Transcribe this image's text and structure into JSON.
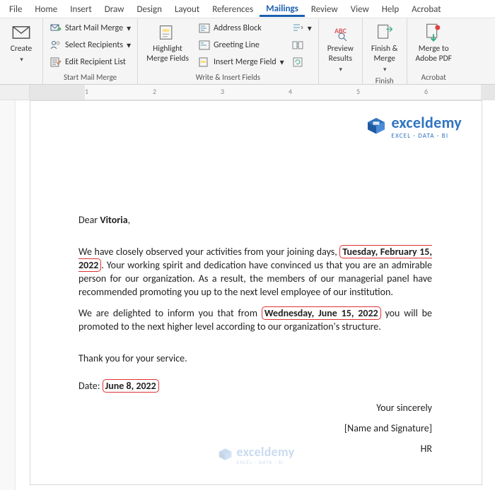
{
  "tabs": [
    "File",
    "Home",
    "Insert",
    "Draw",
    "Design",
    "Layout",
    "References",
    "Mailings",
    "Review",
    "View",
    "Help",
    "Acrobat"
  ],
  "activeTab": "Mailings",
  "ribbon": {
    "create": {
      "label": "Create"
    },
    "startMerge": {
      "groupLabel": "Start Mail Merge",
      "startMailMerge": "Start Mail Merge",
      "selectRecipients": "Select Recipients",
      "editRecipientList": "Edit Recipient List"
    },
    "writeInsert": {
      "groupLabel": "Write & Insert Fields",
      "highlight": "Highlight\nMerge Fields",
      "addressBlock": "Address Block",
      "greetingLine": "Greeting Line",
      "insertMergeField": "Insert Merge Field"
    },
    "preview": {
      "label": "Preview\nResults"
    },
    "finish": {
      "groupLabel": "Finish",
      "label": "Finish &\nMerge"
    },
    "acrobat": {
      "groupLabel": "Acrobat",
      "label": "Merge to\nAdobe PDF"
    }
  },
  "ruler": {
    "nums": [
      "1",
      "2",
      "3",
      "4",
      "5",
      "6"
    ]
  },
  "doc": {
    "greeting_pre": "Dear ",
    "greeting_name": "Vitoria",
    "greeting_post": ",",
    "p1_a": "We have closely observed your activities from your joining days, ",
    "p1_date": "Tuesday, February 15, 2022",
    "p1_b": ". Your working spirit and dedication have convinced us that you are an admirable person for our organization. As a result, the members of our managerial panel have recommended promoting you up to the next level employee of our institution.",
    "p2_a": "We are delighted to inform you that from ",
    "p2_date": "Wednesday, June 15, 2022",
    "p2_b": " you will be promoted to the next higher level according to our organization's structure.",
    "thanks": "Thank you for your service.",
    "date_label": "Date: ",
    "date_val": "June 8, 2022",
    "sig1": "Your sincerely",
    "sig2": "[Name and Signature]",
    "sig3": "HR"
  },
  "logo": {
    "name": "exceldemy",
    "sub": "EXCEL · DATA · BI"
  }
}
